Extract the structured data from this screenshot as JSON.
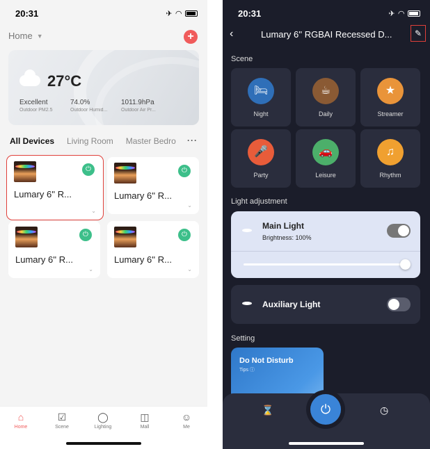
{
  "left": {
    "status_time": "20:31",
    "home_label": "Home",
    "add_symbol": "+",
    "weather": {
      "temp": "27°C",
      "stats": [
        {
          "value": "Excellent",
          "label": "Outdoor PM2.5"
        },
        {
          "value": "74.0%",
          "label": "Outdoor Humid..."
        },
        {
          "value": "1011.9hPa",
          "label": "Outdoor Air Pr..."
        }
      ]
    },
    "tabs": [
      "All Devices",
      "Living Room",
      "Master Bedro"
    ],
    "tabs_more": "···",
    "devices": [
      {
        "name": "Lumary 6'' R..."
      },
      {
        "name": "Lumary 6'' R..."
      },
      {
        "name": "Lumary 6'' R..."
      },
      {
        "name": "Lumary 6'' R..."
      }
    ],
    "nav": [
      {
        "label": "Home",
        "icon": "home-icon",
        "glyph": "⌂"
      },
      {
        "label": "Scene",
        "icon": "scene-icon",
        "glyph": "☑"
      },
      {
        "label": "Lighting",
        "icon": "bulb-icon",
        "glyph": "◯"
      },
      {
        "label": "Mall",
        "icon": "bag-icon",
        "glyph": "◫"
      },
      {
        "label": "Me",
        "icon": "user-icon",
        "glyph": "☺"
      }
    ],
    "colors": {
      "accent": "#f05b5b",
      "power": "#3dbf8a"
    }
  },
  "right": {
    "status_time": "20:31",
    "title": "Lumary 6'' RGBAI Recessed D...",
    "back_glyph": "‹",
    "edit_glyph": "✎",
    "scene_section": "Scene",
    "scenes": [
      {
        "label": "Night",
        "glyph": "🛏",
        "color": "#2f6fb8"
      },
      {
        "label": "Daily",
        "glyph": "☕",
        "color": "#8a5a34"
      },
      {
        "label": "Streamer",
        "glyph": "★",
        "color": "#e9943a"
      },
      {
        "label": "Party",
        "glyph": "🎤",
        "color": "#e85c3a"
      },
      {
        "label": "Leisure",
        "glyph": "🚗",
        "color": "#4caf6a"
      },
      {
        "label": "Rhythm",
        "glyph": "♫",
        "color": "#f0a030"
      }
    ],
    "light_section": "Light adjustment",
    "main_light": {
      "title": "Main Light",
      "brightness": "Brightness: 100%",
      "on": true
    },
    "aux_light": {
      "title": "Auxiliary Light",
      "on": false
    },
    "setting_section": "Setting",
    "dnd": {
      "title": "Do Not Disturb",
      "tips": "Tips ⓘ"
    },
    "bottom": {
      "timer_glyph": "⌛",
      "power_glyph": "⏻",
      "clock_glyph": "◷"
    }
  }
}
